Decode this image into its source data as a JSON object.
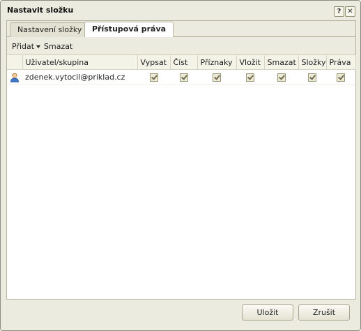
{
  "window": {
    "title": "Nastavit složku",
    "help_label": "?",
    "close_label": "✕"
  },
  "tabs": [
    {
      "label": "Nastavení složky",
      "active": false
    },
    {
      "label": "Přístupová práva",
      "active": true
    }
  ],
  "toolbar": {
    "add_label": "Přidat",
    "delete_label": "Smazat"
  },
  "grid": {
    "columns": [
      "Uživatel/skupina",
      "Vypsat",
      "Číst",
      "Příznaky",
      "Vložit",
      "Smazat",
      "Složky",
      "Práva"
    ],
    "rows": [
      {
        "icon": "user-icon",
        "name": "zdenek.vytocil@priklad.cz",
        "permissions": [
          true,
          true,
          true,
          true,
          true,
          true,
          true
        ]
      }
    ]
  },
  "footer": {
    "save_label": "Uložit",
    "cancel_label": "Zrušit"
  }
}
